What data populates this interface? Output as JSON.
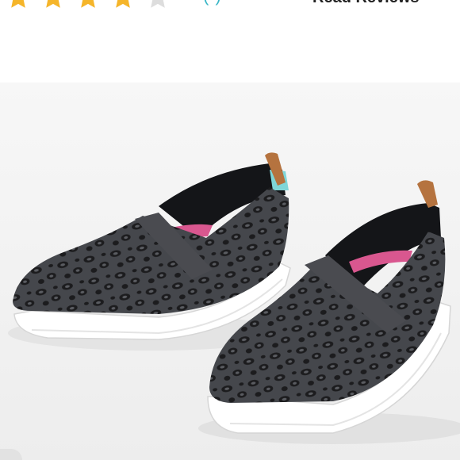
{
  "rating": {
    "stars_filled": 4,
    "stars_total": 5,
    "star_color": "#f5b52a",
    "star_empty_color": "#dddddd"
  },
  "reviews": {
    "count_text": "(  )",
    "read_label": "Read Reviews"
  },
  "product_image": {
    "subject": "shoe",
    "colors": {
      "knit": "#3a3b3f",
      "pattern": "#1c1c1e",
      "sole": "#ffffff",
      "heel_tab": "#b5733f",
      "lining_pink": "#d9578f",
      "lining_teal": "#7fd6d8"
    }
  }
}
